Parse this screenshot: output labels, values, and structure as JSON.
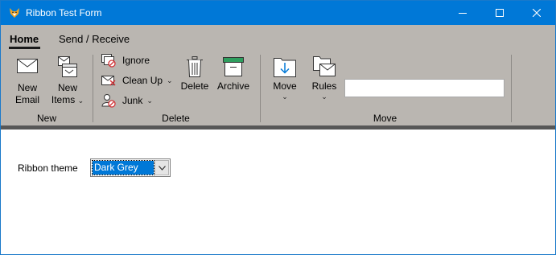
{
  "window": {
    "title": "Ribbon Test Form",
    "titlebar_color": "#0078d7"
  },
  "ribbon": {
    "background_color": "#bab6b1",
    "tabs": [
      {
        "label": "Home",
        "selected": true
      },
      {
        "label": "Send / Receive",
        "selected": false
      }
    ],
    "groups": {
      "new": {
        "label": "New",
        "new_email": {
          "line1": "New",
          "line2": "Email",
          "icon": "envelope-icon"
        },
        "new_items": {
          "line1": "New",
          "line2": "Items",
          "icon": "new-items-icon"
        }
      },
      "delete": {
        "label": "Delete",
        "ignore": {
          "label": "Ignore",
          "icon": "ignore-icon"
        },
        "clean_up": {
          "label": "Clean Up",
          "icon": "clean-up-icon"
        },
        "junk": {
          "label": "Junk",
          "icon": "junk-icon"
        },
        "delete_btn": {
          "label": "Delete",
          "icon": "trash-icon"
        },
        "archive": {
          "label": "Archive",
          "icon": "archive-icon"
        }
      },
      "move": {
        "label": "Move",
        "move_btn": {
          "label": "Move",
          "icon": "move-folder-icon"
        },
        "rules": {
          "label": "Rules",
          "icon": "rules-icon"
        },
        "text_value": ""
      }
    }
  },
  "content": {
    "theme_label": "Ribbon theme",
    "theme_value": "Dark Grey"
  }
}
